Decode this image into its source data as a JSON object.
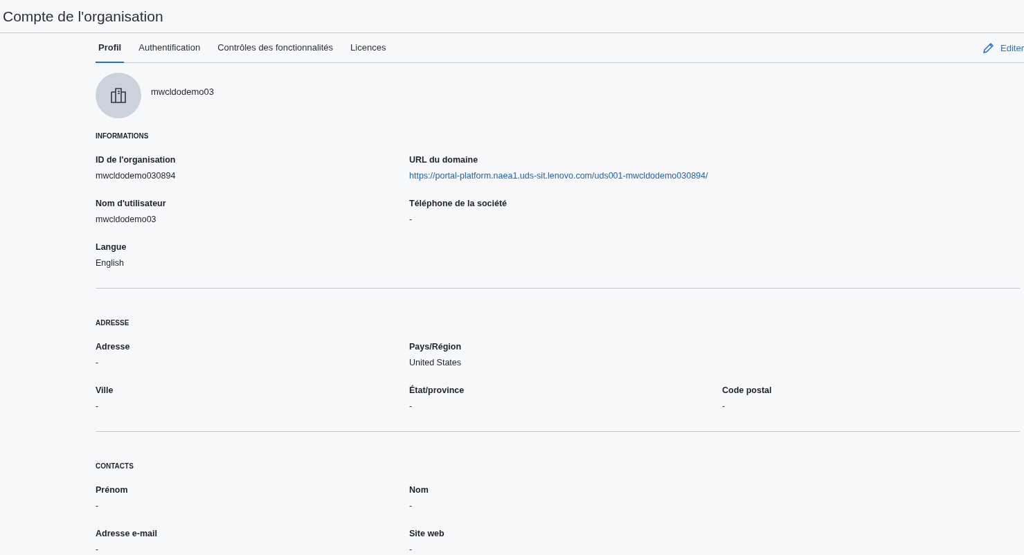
{
  "page_title": "Compte de l'organisation",
  "tabs": [
    {
      "label": "Profil",
      "selected": true
    },
    {
      "label": "Authentification",
      "selected": false
    },
    {
      "label": "Contrôles des fonctionnalités",
      "selected": false
    },
    {
      "label": "Licences",
      "selected": false
    }
  ],
  "edit_button": {
    "label": "Editer"
  },
  "profile": {
    "name": "mwcldodemo03"
  },
  "sections": [
    {
      "title": "INFORMATIONS",
      "rows": [
        [
          {
            "label": "ID de l'organisation",
            "value": "mwcldodemo030894",
            "kind": "text"
          },
          {
            "label": "URL du domaine",
            "value": "https://portal-platform.naea1.uds-sit.lenovo.com/uds001-mwcldodemo030894/",
            "kind": "link"
          }
        ],
        [
          {
            "label": "Nom d'utilisateur",
            "value": "mwcldodemo03",
            "kind": "text"
          },
          {
            "label": "Téléphone de la société",
            "value": "-",
            "kind": "text"
          }
        ],
        [
          {
            "label": "Langue",
            "value": "English",
            "kind": "text"
          }
        ]
      ]
    },
    {
      "title": "ADRESSE",
      "rows": [
        [
          {
            "label": "Adresse",
            "value": "-",
            "kind": "text"
          },
          {
            "label": "Pays/Région",
            "value": "United States",
            "kind": "text"
          }
        ],
        [
          {
            "label": "Ville",
            "value": "-",
            "kind": "text"
          },
          {
            "label": "État/province",
            "value": "-",
            "kind": "text"
          },
          {
            "label": "Code postal",
            "value": "-",
            "kind": "text"
          }
        ]
      ]
    },
    {
      "title": "CONTACTS",
      "rows": [
        [
          {
            "label": "Prénom",
            "value": "-",
            "kind": "text"
          },
          {
            "label": "Nom",
            "value": "-",
            "kind": "text"
          }
        ],
        [
          {
            "label": "Adresse e-mail",
            "value": "-",
            "kind": "text"
          },
          {
            "label": "Site web",
            "value": "-",
            "kind": "text"
          }
        ]
      ]
    }
  ]
}
